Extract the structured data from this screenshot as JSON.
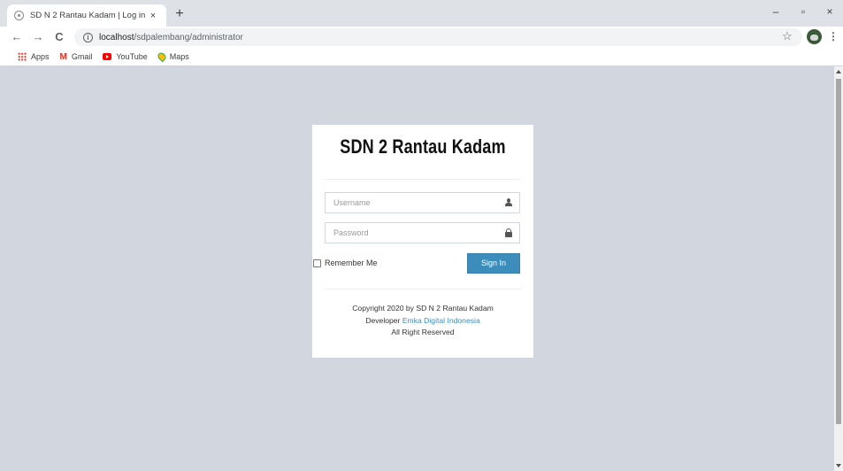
{
  "browser": {
    "tab": {
      "title": "SD N 2 Rantau Kadam | Log in",
      "close_glyph": "×"
    },
    "new_tab_glyph": "+",
    "window_controls": {
      "minimize": "–",
      "restore": "▫",
      "close": "×"
    },
    "nav": {
      "back": "←",
      "forward": "→",
      "reload": "C"
    },
    "address": {
      "host": "localhost",
      "path": "/sdpalembang/administrator"
    },
    "star_glyph": "☆",
    "menu_glyph": "⋮",
    "bookmarks": [
      {
        "label": "Apps",
        "icon": "apps-grid-icon"
      },
      {
        "label": "Gmail",
        "icon": "gmail-icon",
        "glyph": "M"
      },
      {
        "label": "YouTube",
        "icon": "youtube-icon"
      },
      {
        "label": "Maps",
        "icon": "maps-icon"
      }
    ]
  },
  "login": {
    "logo": "SDN 2 Rantau Kadam",
    "username_placeholder": "Username",
    "password_placeholder": "Password",
    "remember_label": "Remember Me",
    "signin_label": "Sign In",
    "footer": {
      "line1": "Copyright 2020 by SD N 2 Rantau Kadam",
      "developer_prefix": "Developer ",
      "developer_link": "Emka Digital Indonesia",
      "line3": "All Right Reserved"
    }
  },
  "colors": {
    "page_background": "#d2d6de",
    "primary_button": "#3c8dbc",
    "link": "#3c8dbc"
  }
}
